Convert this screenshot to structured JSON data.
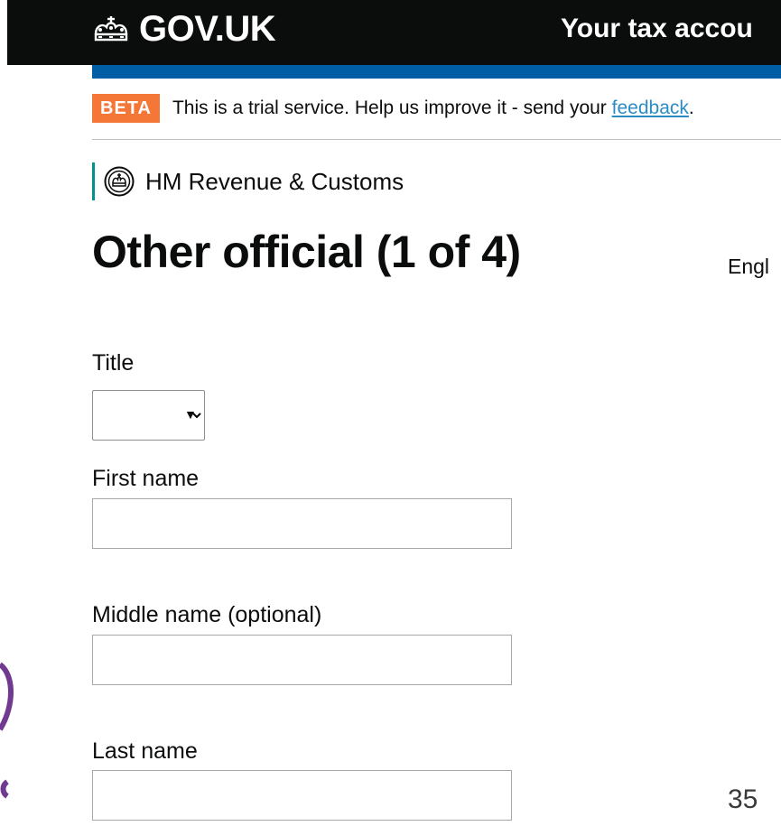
{
  "header": {
    "logo_text": "GOV.UK",
    "logo_icon": "crown-icon",
    "service_name": "Your tax accou"
  },
  "phase_banner": {
    "tag": "BETA",
    "text_before": "This is a trial service. Help us improve it - send your ",
    "link_text": "feedback",
    "text_after": "."
  },
  "organisation": {
    "icon": "hmrc-crest-icon",
    "name": "HM Revenue & Customs"
  },
  "page": {
    "title": "Other official (1 of 4)",
    "language_link": "Engl"
  },
  "form": {
    "title_label": "Title",
    "title_selected": "",
    "first_name_label": "First name",
    "first_name_value": "",
    "middle_name_label": "Middle name (optional)",
    "middle_name_value": "",
    "last_name_label": "Last name",
    "last_name_value": ""
  },
  "slide": {
    "number": "35"
  },
  "colors": {
    "header_bg": "#0b0c0c",
    "header_bar": "#005ea5",
    "beta_tag": "#f47738",
    "link": "#2b8cc4",
    "org_stripe": "#009390",
    "deco_purple": "#6f3a8f"
  }
}
